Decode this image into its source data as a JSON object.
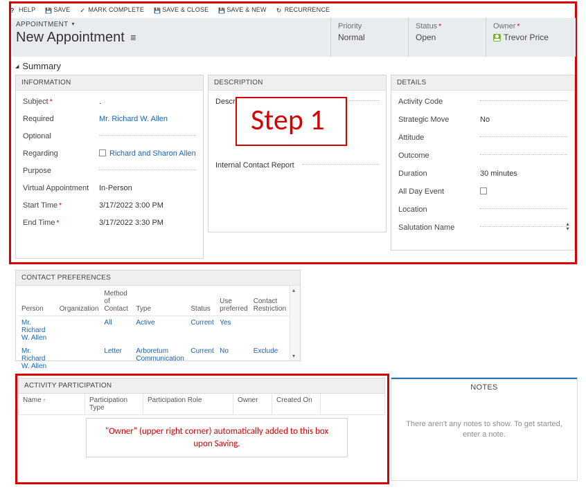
{
  "toolbar": {
    "help": "HELP",
    "save": "SAVE",
    "mark_complete": "MARK COMPLETE",
    "save_close": "SAVE & CLOSE",
    "save_new": "SAVE & NEW",
    "recurrence": "RECURRENCE"
  },
  "header": {
    "breadcrumb": "APPOINTMENT",
    "title": "New Appointment",
    "priority_label": "Priority",
    "priority_value": "Normal",
    "status_label": "Status",
    "status_value": "Open",
    "owner_label": "Owner",
    "owner_value": "Trevor Price"
  },
  "summary_heading": "Summary",
  "info": {
    "panel_title": "INFORMATION",
    "subject_label": "Subject",
    "subject_value": ".",
    "required_label": "Required",
    "required_value": "Mr. Richard W. Allen",
    "optional_label": "Optional",
    "optional_value": "",
    "regarding_label": "Regarding",
    "regarding_value": "Richard and Sharon Allen",
    "purpose_label": "Purpose",
    "purpose_value": "",
    "virtual_label": "Virtual Appointment",
    "virtual_value": "In-Person",
    "start_label": "Start Time",
    "start_value": "3/17/2022  3:00 PM",
    "end_label": "End Time",
    "end_value": "3/17/2022  3:30 PM"
  },
  "desc": {
    "panel_title": "DESCRIPTION",
    "description_label": "Descr",
    "description_value": "",
    "icr_label": "Internal Contact Report",
    "icr_value": ""
  },
  "det": {
    "panel_title": "DETAILS",
    "activity_code_label": "Activity Code",
    "activity_code_value": "",
    "strategic_label": "Strategic Move",
    "strategic_value": "No",
    "attitude_label": "Attitude",
    "attitude_value": "",
    "outcome_label": "Outcome",
    "outcome_value": "",
    "duration_label": "Duration",
    "duration_value": "30 minutes",
    "allday_label": "All Day Event",
    "allday_value": "",
    "location_label": "Location",
    "location_value": "",
    "salutation_label": "Salutation Name",
    "salutation_value": ""
  },
  "cp": {
    "panel_title": "CONTACT PREFERENCES",
    "cols": {
      "person": "Person",
      "organization": "Organization",
      "method": "Method of Contact",
      "type": "Type",
      "status": "Status",
      "use_pref": "Use preferred",
      "restriction": "Contact Restriction"
    },
    "rows": [
      {
        "person": "Mr. Richard W. Allen",
        "organization": "",
        "method": "All",
        "type": "Active",
        "status": "Current",
        "use_pref": "Yes",
        "restriction": ""
      },
      {
        "person": "Mr. Richard W. Allen",
        "organization": "",
        "method": "Letter",
        "type": "Arboretum Communication",
        "status": "Current",
        "use_pref": "No",
        "restriction": "Exclude"
      }
    ]
  },
  "ap": {
    "panel_title": "ACTIVITY PARTICIPATION",
    "cols": {
      "name": "Name",
      "ptype": "Participation Type",
      "prole": "Participation Role",
      "owner": "Owner",
      "created": "Created On"
    }
  },
  "notes": {
    "title": "NOTES",
    "empty": "There aren't any notes to show. To get started, enter a note."
  },
  "annotations": {
    "step1": "Step 1",
    "owner_note": "\"Owner\" (upper right corner) automatically added to this box upon Saving."
  }
}
